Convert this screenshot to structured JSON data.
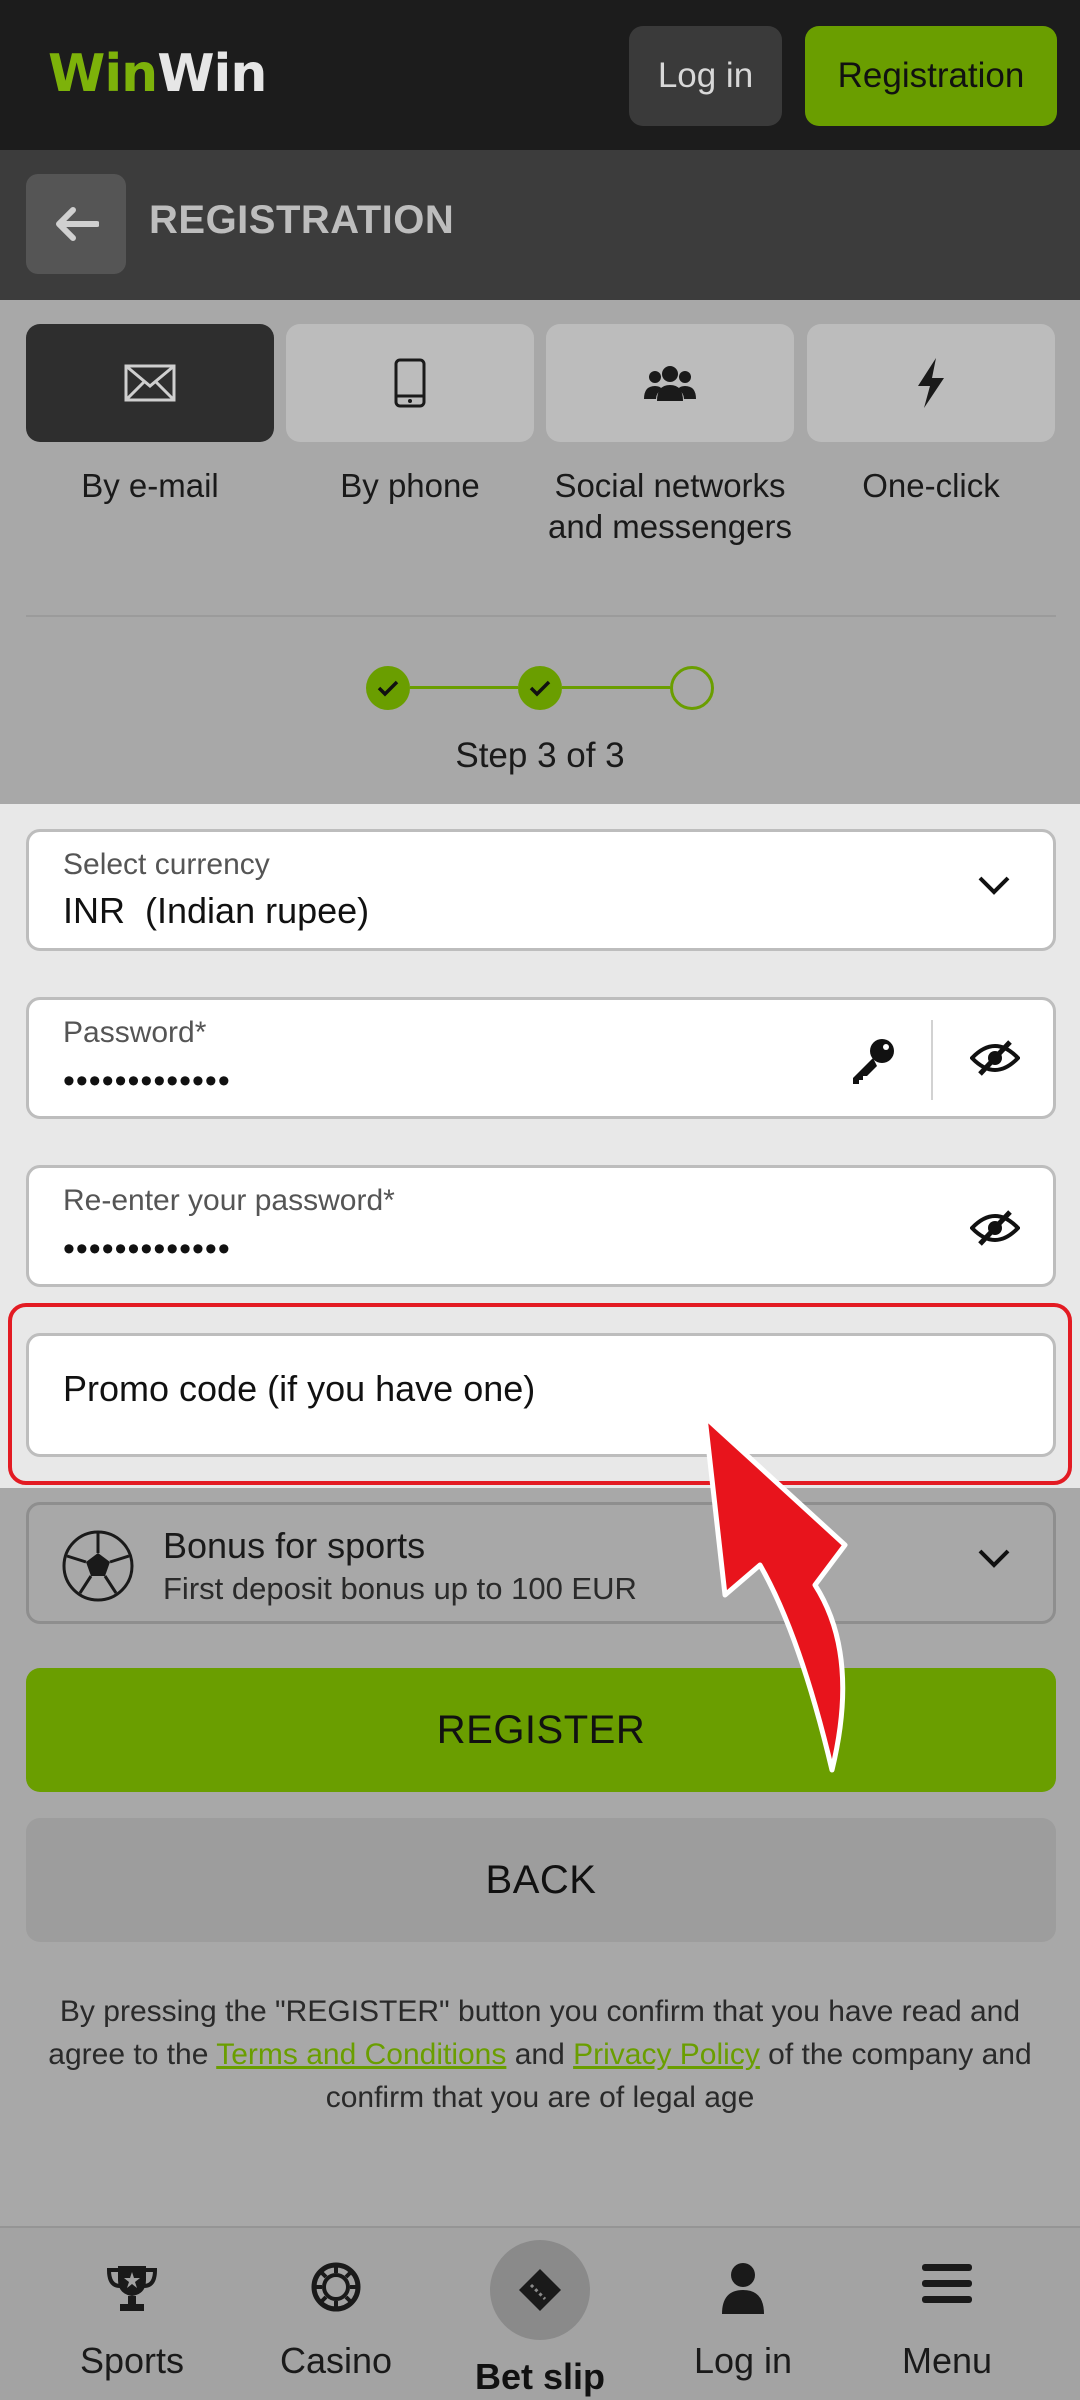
{
  "header": {
    "logo_part1": "Win",
    "logo_part2": "Win",
    "login_label": "Log in",
    "registration_label": "Registration"
  },
  "titlebar": {
    "title": "REGISTRATION"
  },
  "methods": [
    {
      "label": "By e-mail",
      "icon": "envelope-icon",
      "active": true
    },
    {
      "label": "By phone",
      "icon": "phone-icon",
      "active": false
    },
    {
      "label": "Social networks and messengers",
      "icon": "users-icon",
      "active": false
    },
    {
      "label": "One-click",
      "icon": "lightning-icon",
      "active": false
    }
  ],
  "stepper": {
    "text": "Step 3 of 3",
    "current": 3,
    "total": 3
  },
  "form": {
    "currency_label": "Select currency",
    "currency_code": "INR",
    "currency_name": "(Indian rupee)",
    "password_label": "Password*",
    "password_value": "•••••••••••••",
    "repassword_label": "Re-enter your password*",
    "repassword_value": "•••••••••••••",
    "promo_placeholder": "Promo code (if you have one)"
  },
  "bonus": {
    "title": "Bonus for sports",
    "subtitle": "First deposit bonus up to 100 EUR"
  },
  "buttons": {
    "register": "REGISTER",
    "back": "BACK"
  },
  "legal": {
    "part1": "By pressing the \"REGISTER\" button you confirm that you have read and agree to the ",
    "terms_link": "Terms and Conditions",
    "part2": " and ",
    "privacy_link": "Privacy Policy",
    "part3": " of the company and confirm that you are of legal age"
  },
  "bottom_nav": {
    "sports": "Sports",
    "casino": "Casino",
    "betslip": "Bet slip",
    "login": "Log in",
    "menu": "Menu"
  },
  "colors": {
    "brand_green": "#6a9e00",
    "highlight_red": "#e31b23",
    "header_dark": "#1c1c1c"
  }
}
